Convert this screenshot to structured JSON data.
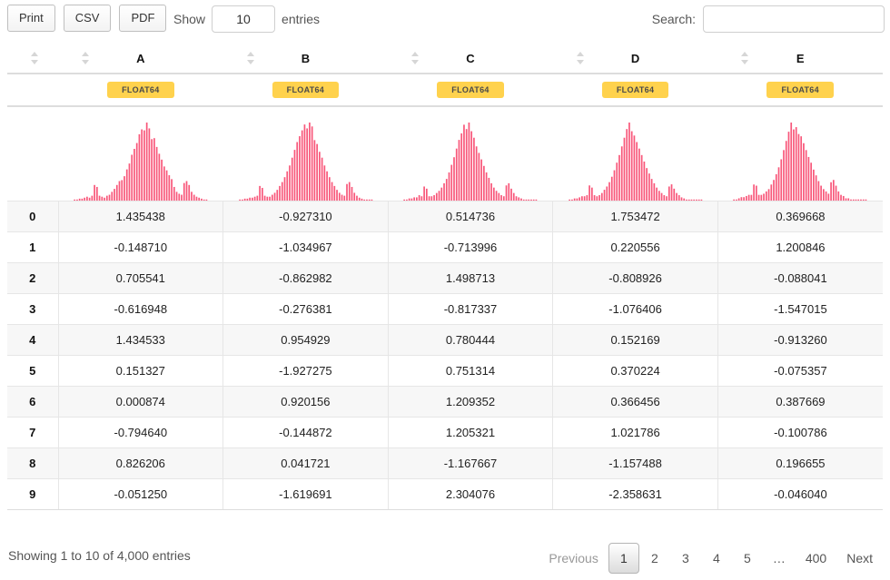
{
  "toolbar": {
    "buttons": [
      {
        "label": "Print",
        "name": "print-button"
      },
      {
        "label": "CSV",
        "name": "csv-button"
      },
      {
        "label": "PDF",
        "name": "pdf-button"
      }
    ],
    "length": {
      "prefix": "Show",
      "value": "10",
      "suffix": "entries"
    },
    "search": {
      "label": "Search:",
      "value": "",
      "placeholder": ""
    }
  },
  "table": {
    "index_header": "",
    "columns": [
      {
        "label": "A",
        "dtype": "FLOAT64"
      },
      {
        "label": "B",
        "dtype": "FLOAT64"
      },
      {
        "label": "C",
        "dtype": "FLOAT64"
      },
      {
        "label": "D",
        "dtype": "FLOAT64"
      },
      {
        "label": "E",
        "dtype": "FLOAT64"
      }
    ],
    "rows": [
      {
        "index": "0",
        "values": [
          "1.435438",
          "-0.927310",
          "0.514736",
          "1.753472",
          "0.369668"
        ]
      },
      {
        "index": "1",
        "values": [
          "-0.148710",
          "-1.034967",
          "-0.713996",
          "0.220556",
          "1.200846"
        ]
      },
      {
        "index": "2",
        "values": [
          "0.705541",
          "-0.862982",
          "1.498713",
          "-0.808926",
          "-0.088041"
        ]
      },
      {
        "index": "3",
        "values": [
          "-0.616948",
          "-0.276381",
          "-0.817337",
          "-1.076406",
          "-1.547015"
        ]
      },
      {
        "index": "4",
        "values": [
          "1.434533",
          "0.954929",
          "0.780444",
          "0.152169",
          "-0.913260"
        ]
      },
      {
        "index": "5",
        "values": [
          "0.151327",
          "-1.927275",
          "0.751314",
          "0.370224",
          "-0.075357"
        ]
      },
      {
        "index": "6",
        "values": [
          "0.000874",
          "0.920156",
          "1.209352",
          "0.366456",
          "0.387669"
        ]
      },
      {
        "index": "7",
        "values": [
          "-0.794640",
          "-0.144872",
          "1.205321",
          "1.021786",
          "-0.100786"
        ]
      },
      {
        "index": "8",
        "values": [
          "0.826206",
          "0.041721",
          "-1.167667",
          "-1.157488",
          "0.196655"
        ]
      },
      {
        "index": "9",
        "values": [
          "-0.051250",
          "-1.619691",
          "2.304076",
          "-2.358631",
          "-0.046040"
        ]
      }
    ]
  },
  "histograms": {
    "type": "bar",
    "bar_color": "#f8577a",
    "series": [
      {
        "name": "A",
        "values": [
          1,
          1,
          2,
          2,
          3,
          4,
          3,
          5,
          16,
          14,
          5,
          4,
          3,
          5,
          6,
          9,
          12,
          16,
          20,
          21,
          25,
          32,
          38,
          47,
          53,
          59,
          68,
          73,
          72,
          80,
          74,
          63,
          64,
          55,
          48,
          42,
          35,
          31,
          26,
          22,
          14,
          9,
          7,
          6,
          18,
          20,
          16,
          9,
          6,
          4,
          3,
          2,
          1,
          1
        ]
      },
      {
        "name": "B",
        "values": [
          1,
          1,
          2,
          2,
          3,
          3,
          4,
          5,
          15,
          13,
          5,
          4,
          4,
          6,
          8,
          11,
          15,
          19,
          24,
          30,
          36,
          44,
          52,
          60,
          66,
          72,
          78,
          74,
          80,
          76,
          62,
          58,
          50,
          44,
          36,
          30,
          24,
          19,
          15,
          11,
          8,
          6,
          5,
          17,
          19,
          14,
          8,
          5,
          3,
          2,
          1,
          1,
          1,
          1
        ]
      },
      {
        "name": "C",
        "values": [
          1,
          1,
          2,
          2,
          3,
          3,
          5,
          4,
          13,
          11,
          4,
          4,
          5,
          7,
          9,
          12,
          16,
          20,
          26,
          33,
          40,
          48,
          56,
          62,
          70,
          66,
          72,
          64,
          58,
          50,
          44,
          38,
          32,
          26,
          21,
          16,
          12,
          9,
          7,
          5,
          4,
          14,
          16,
          11,
          7,
          4,
          3,
          2,
          1,
          1,
          1,
          1,
          1,
          1
        ]
      },
      {
        "name": "D",
        "values": [
          1,
          1,
          2,
          2,
          3,
          4,
          4,
          5,
          14,
          12,
          5,
          4,
          5,
          7,
          10,
          13,
          17,
          22,
          28,
          35,
          42,
          50,
          58,
          66,
          72,
          64,
          60,
          54,
          48,
          42,
          36,
          30,
          25,
          20,
          16,
          12,
          9,
          7,
          5,
          4,
          13,
          15,
          11,
          7,
          5,
          3,
          2,
          1,
          1,
          1,
          1,
          1,
          1,
          1
        ]
      },
      {
        "name": "E",
        "values": [
          1,
          1,
          2,
          3,
          3,
          4,
          5,
          5,
          14,
          13,
          5,
          5,
          6,
          8,
          10,
          14,
          18,
          23,
          29,
          36,
          44,
          52,
          60,
          68,
          62,
          64,
          58,
          56,
          50,
          44,
          38,
          33,
          27,
          22,
          17,
          13,
          10,
          8,
          6,
          16,
          18,
          13,
          8,
          5,
          4,
          2,
          2,
          1,
          1,
          1,
          1,
          1,
          1,
          1
        ]
      }
    ]
  },
  "footer": {
    "info": "Showing 1 to 10 of 4,000 entries",
    "pagination": [
      {
        "label": "Previous",
        "state": "disabled",
        "name": "page-previous"
      },
      {
        "label": "1",
        "state": "current",
        "name": "page-1"
      },
      {
        "label": "2",
        "state": "normal",
        "name": "page-2"
      },
      {
        "label": "3",
        "state": "normal",
        "name": "page-3"
      },
      {
        "label": "4",
        "state": "normal",
        "name": "page-4"
      },
      {
        "label": "5",
        "state": "normal",
        "name": "page-5"
      },
      {
        "label": "…",
        "state": "ellipsis",
        "name": "page-ellipsis"
      },
      {
        "label": "400",
        "state": "normal",
        "name": "page-400"
      },
      {
        "label": "Next",
        "state": "normal",
        "name": "page-next"
      }
    ]
  }
}
